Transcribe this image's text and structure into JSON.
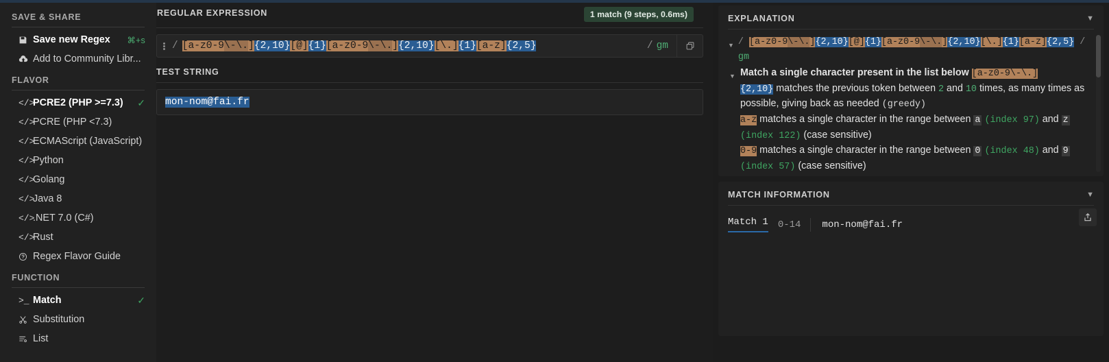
{
  "sidebar": {
    "save_share": {
      "title": "SAVE & SHARE",
      "items": [
        {
          "label": "Save new Regex",
          "icon": "floppy-disk-icon",
          "shortcut": "⌘+s",
          "active": true
        },
        {
          "label": "Add to Community Libr...",
          "icon": "cloud-upload-icon",
          "shortcut": "",
          "active": false
        }
      ]
    },
    "flavor": {
      "title": "FLAVOR",
      "items": [
        {
          "label": "PCRE2 (PHP >=7.3)",
          "icon": "code-icon",
          "selected": true
        },
        {
          "label": "PCRE (PHP <7.3)",
          "icon": "code-icon",
          "selected": false
        },
        {
          "label": "ECMAScript (JavaScript)",
          "icon": "code-icon",
          "selected": false
        },
        {
          "label": "Python",
          "icon": "code-icon",
          "selected": false
        },
        {
          "label": "Golang",
          "icon": "code-icon",
          "selected": false
        },
        {
          "label": "Java 8",
          "icon": "code-icon",
          "selected": false
        },
        {
          "label": ".NET 7.0 (C#)",
          "icon": "code-icon",
          "selected": false
        },
        {
          "label": "Rust",
          "icon": "code-icon",
          "selected": false
        },
        {
          "label": "Regex Flavor Guide",
          "icon": "question-circle-icon",
          "selected": false
        }
      ]
    },
    "function": {
      "title": "FUNCTION",
      "items": [
        {
          "label": "Match",
          "icon": "terminal-icon",
          "selected": true
        },
        {
          "label": "Substitution",
          "icon": "scissors-icon",
          "selected": false
        },
        {
          "label": "List",
          "icon": "list-icon",
          "selected": false
        }
      ]
    }
  },
  "regex_panel": {
    "title": "REGULAR EXPRESSION",
    "match_badge": "1 match (9 steps, 0.6ms)",
    "delimiter": "/",
    "flags": "gm",
    "copy_icon": "copy-icon",
    "drag_handle_icon": "kebab-menu-icon",
    "tokens": [
      {
        "text": "[a-z0-9",
        "type": "class"
      },
      {
        "text": "\\-\\.",
        "type": "escape"
      },
      {
        "text": "]",
        "type": "class"
      },
      {
        "text": "{2,10}",
        "type": "quant"
      },
      {
        "text": "[@]",
        "type": "class"
      },
      {
        "text": "{1}",
        "type": "quant"
      },
      {
        "text": "[a-z0-9",
        "type": "class"
      },
      {
        "text": "\\-\\.",
        "type": "escape"
      },
      {
        "text": "]",
        "type": "class"
      },
      {
        "text": "{2,10}",
        "type": "quant"
      },
      {
        "text": "[\\.]",
        "type": "class"
      },
      {
        "text": "{1}",
        "type": "quant"
      },
      {
        "text": "[a-z]",
        "type": "class"
      },
      {
        "text": "{2,5}",
        "type": "quant"
      }
    ]
  },
  "test_string_panel": {
    "title": "TEST STRING",
    "content": "mon-nom@fai.fr",
    "match_highlight": true
  },
  "explanation_panel": {
    "title": "EXPLANATION",
    "collapse_icon": "chevron-down-icon",
    "regex_line": {
      "open_slash": "/",
      "close_slash": "/",
      "flags": "gm"
    },
    "entries": [
      {
        "heading": "Match a single character present in the list below",
        "heading_token": "[a-z0-9\\-\\.]",
        "lines": [
          {
            "parts": [
              {
                "text": "{2,10}",
                "style": "quant"
              },
              {
                "text": " matches the previous token between ",
                "style": "plain"
              },
              {
                "text": "2",
                "style": "num"
              },
              {
                "text": " and ",
                "style": "plain"
              },
              {
                "text": "10",
                "style": "num"
              },
              {
                "text": " times, as many times as possible, giving back as needed ",
                "style": "plain"
              },
              {
                "text": "(greedy)",
                "style": "mono"
              }
            ]
          },
          {
            "parts": [
              {
                "text": "a-z",
                "style": "class"
              },
              {
                "text": " matches a single character in the range between ",
                "style": "plain"
              },
              {
                "text": "a",
                "style": "chip"
              },
              {
                "text": " ",
                "style": "plain"
              },
              {
                "text": "(index 97)",
                "style": "idx"
              },
              {
                "text": " and ",
                "style": "plain"
              },
              {
                "text": "z",
                "style": "chip"
              },
              {
                "text": " ",
                "style": "plain"
              },
              {
                "text": "(index 122)",
                "style": "idx"
              },
              {
                "text": " (case sensitive)",
                "style": "plain"
              }
            ]
          },
          {
            "parts": [
              {
                "text": "0-9",
                "style": "class"
              },
              {
                "text": " matches a single character in the range between ",
                "style": "plain"
              },
              {
                "text": "0",
                "style": "chip"
              },
              {
                "text": " ",
                "style": "plain"
              },
              {
                "text": "(index 48)",
                "style": "idx"
              },
              {
                "text": " and ",
                "style": "plain"
              },
              {
                "text": "9",
                "style": "chip"
              },
              {
                "text": " ",
                "style": "plain"
              },
              {
                "text": "(index 57)",
                "style": "idx"
              },
              {
                "text": " (case sensitive)",
                "style": "plain"
              }
            ]
          }
        ]
      }
    ]
  },
  "match_information_panel": {
    "title": "MATCH INFORMATION",
    "collapse_icon": "chevron-down-icon",
    "export_icon": "export-icon",
    "match_label": "Match 1",
    "match_range": "0-14",
    "match_value": "mon-nom@fai.fr"
  },
  "colors": {
    "accent_blue": "#2a5d93",
    "class_token": "#b2825a",
    "flag_green": "#4fae74",
    "badge_bg": "#2b4434"
  }
}
